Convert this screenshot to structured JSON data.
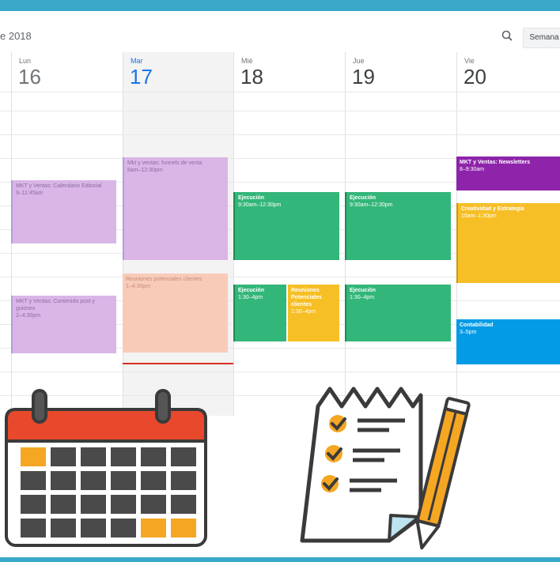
{
  "header": {
    "month_title": "e 2018",
    "view_button": "Semana"
  },
  "days": [
    {
      "dow": "Lun",
      "num": "16"
    },
    {
      "dow": "Mar",
      "num": "17"
    },
    {
      "dow": "Mié",
      "num": "18"
    },
    {
      "dow": "Jue",
      "num": "19"
    },
    {
      "dow": "Vie",
      "num": "20"
    }
  ],
  "events": [
    {
      "title": "MKT y Ventas: Calendario Editorial",
      "time": "9–11:45am",
      "color": "#d9b6e6"
    },
    {
      "title": "MKT y Ventas: Contenido post y guiones",
      "time": "2–4:30pm",
      "color": "#d9b6e6"
    },
    {
      "title": "Mkt y ventas: funnels de venta",
      "time": "8am–12:30pm",
      "color": "#d9b6e6"
    },
    {
      "title": "Reuniones potenciales clientes",
      "time": "1–4:30pm",
      "color": "#f8cbb9"
    },
    {
      "title": "Ejecución",
      "time": "9:30am–12:30pm",
      "color": "#33b679"
    },
    {
      "title": "Ejecución",
      "time": "1:30–4pm",
      "color": "#33b679"
    },
    {
      "title": "Reuniones Potenciales clientes",
      "time": "1:30–4pm",
      "color": "#f6bf26"
    },
    {
      "title": "Ejecución",
      "time": "9:30am–12:30pm",
      "color": "#33b679"
    },
    {
      "title": "Ejecución",
      "time": "1:30–4pm",
      "color": "#33b679"
    },
    {
      "title": "MKT y Ventas: Newsletters",
      "time": "8–9:30am",
      "color": "#8e24aa"
    },
    {
      "title": "Creatividad y Estrategia",
      "time": "10am–1:30pm",
      "color": "#f6bf26"
    },
    {
      "title": "Contabilidad",
      "time": "3–5pm",
      "color": "#039be5"
    }
  ],
  "colors": {
    "frame": "#3aa8c9",
    "today_accent": "#1a73e8",
    "now_indicator": "#d93025",
    "calendar_icon_red": "#e8492c",
    "calendar_icon_highlight": "#f5a623",
    "checklist_accent": "#f5a623"
  },
  "icons": [
    "search-icon",
    "calendar-illustration",
    "checklist-illustration",
    "pencil-icon"
  ]
}
